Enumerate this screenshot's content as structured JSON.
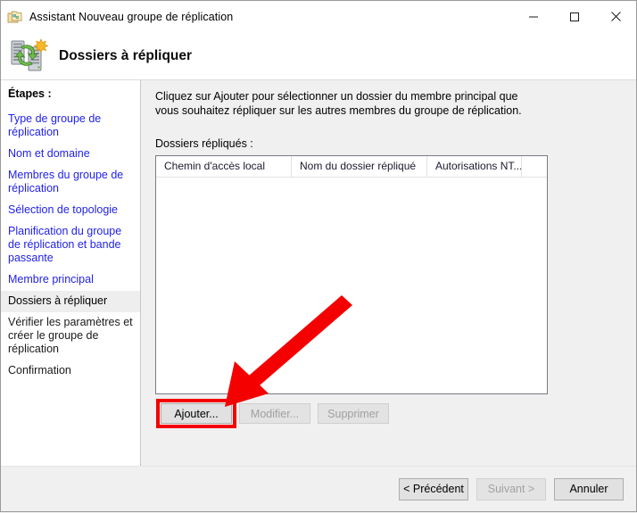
{
  "window": {
    "title": "Assistant Nouveau groupe de réplication",
    "title_icon": "folders-replication-icon",
    "controls": {
      "minimize": "minimize-icon",
      "maximize": "maximize-icon",
      "close": "close-icon"
    }
  },
  "header": {
    "title": "Dossiers à répliquer",
    "icon": "servers-replication-star-icon"
  },
  "sidebar": {
    "label": "Étapes :",
    "items": [
      {
        "label": "Type de groupe de réplication",
        "state": "done"
      },
      {
        "label": "Nom et domaine",
        "state": "done"
      },
      {
        "label": "Membres du groupe de réplication",
        "state": "done"
      },
      {
        "label": "Sélection de topologie",
        "state": "done"
      },
      {
        "label": "Planification du groupe de réplication et bande passante",
        "state": "done"
      },
      {
        "label": "Membre principal",
        "state": "done"
      },
      {
        "label": "Dossiers à répliquer",
        "state": "current"
      },
      {
        "label": "Vérifier les paramètres et créer le groupe de réplication",
        "state": "future"
      },
      {
        "label": "Confirmation",
        "state": "future"
      }
    ]
  },
  "main": {
    "description": "Cliquez sur Ajouter pour sélectionner un dossier du membre principal que vous souhaitez répliquer sur les autres membres du groupe de réplication.",
    "list_label": "Dossiers répliqués :",
    "table": {
      "columns": [
        "Chemin d'accès local",
        "Nom du dossier répliqué",
        "Autorisations NT...",
        ""
      ],
      "rows": []
    },
    "actions": [
      {
        "label": "Ajouter...",
        "enabled": true,
        "highlighted": true
      },
      {
        "label": "Modifier...",
        "enabled": false,
        "highlighted": false
      },
      {
        "label": "Supprimer",
        "enabled": false,
        "highlighted": false
      }
    ]
  },
  "footer": {
    "buttons": [
      {
        "label": "< Précédent",
        "enabled": true
      },
      {
        "label": "Suivant >",
        "enabled": false
      },
      {
        "label": "Annuler",
        "enabled": true
      }
    ]
  },
  "annotation": {
    "type": "red-arrow-and-box",
    "color": "#f40000",
    "target": "Ajouter..."
  }
}
